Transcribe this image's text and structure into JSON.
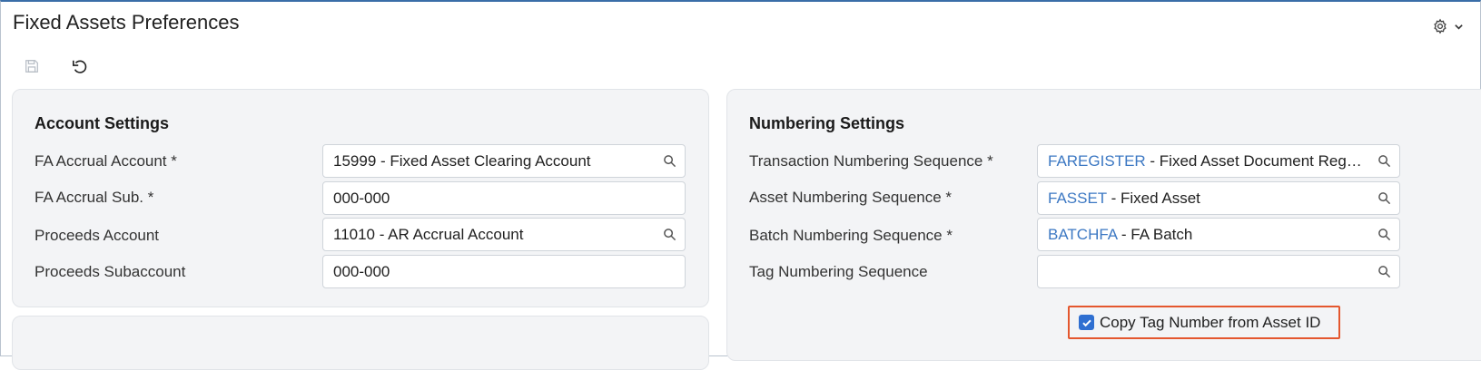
{
  "header": {
    "title": "Fixed Assets Preferences"
  },
  "toolbar": {
    "save_icon": "save-icon",
    "undo_icon": "undo-icon",
    "settings_icon": "gear-icon"
  },
  "account_settings": {
    "title": "Account Settings",
    "fields": [
      {
        "label": "FA Accrual Account *",
        "value": "15999 - Fixed Asset Clearing Account",
        "has_search": true
      },
      {
        "label": "FA Accrual Sub. *",
        "value": "000-000",
        "has_search": false
      },
      {
        "label": "Proceeds Account",
        "value": "11010 - AR Accrual Account",
        "has_search": true
      },
      {
        "label": "Proceeds Subaccount",
        "value": "000-000",
        "has_search": false
      }
    ]
  },
  "numbering_settings": {
    "title": "Numbering Settings",
    "fields": [
      {
        "label": "Transaction Numbering Sequence *",
        "link": "FAREGISTER",
        "desc": " - Fixed Asset Document Regis...",
        "has_search": true
      },
      {
        "label": "Asset Numbering Sequence *",
        "link": "FASSET",
        "desc": " - Fixed Asset",
        "has_search": true
      },
      {
        "label": "Batch Numbering Sequence *",
        "link": "BATCHFA",
        "desc": " - FA Batch",
        "has_search": true
      },
      {
        "label": "Tag Numbering Sequence",
        "link": "",
        "desc": "",
        "has_search": true
      }
    ],
    "copy_tag_checkbox": {
      "label": "Copy Tag Number from Asset ID",
      "checked": true
    }
  },
  "colors": {
    "accent": "#3c78c3",
    "highlight_border": "#e4572e",
    "panel_bg": "#f3f4f6"
  }
}
